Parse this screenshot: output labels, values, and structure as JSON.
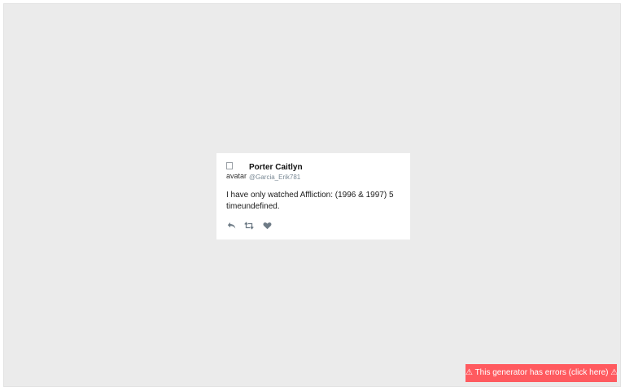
{
  "tweet": {
    "avatar_alt": "avatar",
    "display_name": "Porter Caitlyn",
    "handle": "@Garcia_Erik781",
    "text": "I have only watched Affliction: (1996 & 1997) 5 timeundefined.",
    "actions": {
      "reply_icon": "reply-icon",
      "retweet_icon": "retweet-icon",
      "like_icon": "heart-icon"
    }
  },
  "error_banner": {
    "label": "⚠ This generator has errors (click here) ⚠"
  },
  "colors": {
    "canvas_bg": "#ebebeb",
    "card_bg": "#ffffff",
    "icon_color": "#6e7b86",
    "handle_color": "#7b8a96",
    "error_bg": "#ff5a5f"
  }
}
